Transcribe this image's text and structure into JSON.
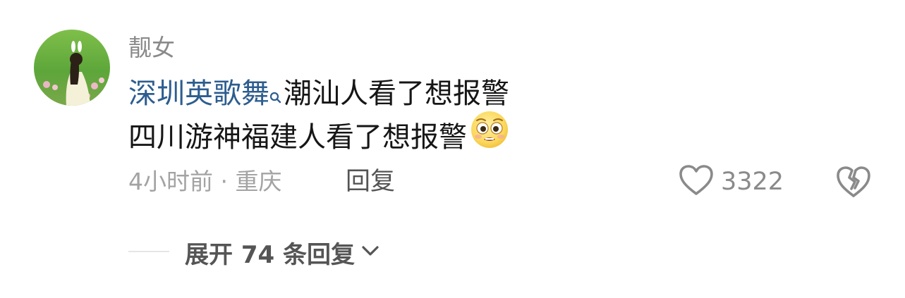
{
  "comment": {
    "username": "靓女",
    "hashtag": "深圳英歌舞",
    "text_line1_rest": "潮汕人看了想报警",
    "text_line2": "四川游神福建人看了想报警",
    "emoji": "pleading-face-emoji",
    "time_location": "4小时前 · 重庆",
    "reply_label": "回复",
    "like_count": "3322",
    "like_icon": "heart-outline-icon",
    "dislike_icon": "broken-heart-icon"
  },
  "replies": {
    "expand_label": "展开 74 条回复",
    "expand_icon": "chevron-down-icon"
  },
  "colors": {
    "hashtag": "#2d5d8f",
    "username": "#8a8a8a",
    "meta": "#a3a3a3",
    "text": "#161616"
  }
}
